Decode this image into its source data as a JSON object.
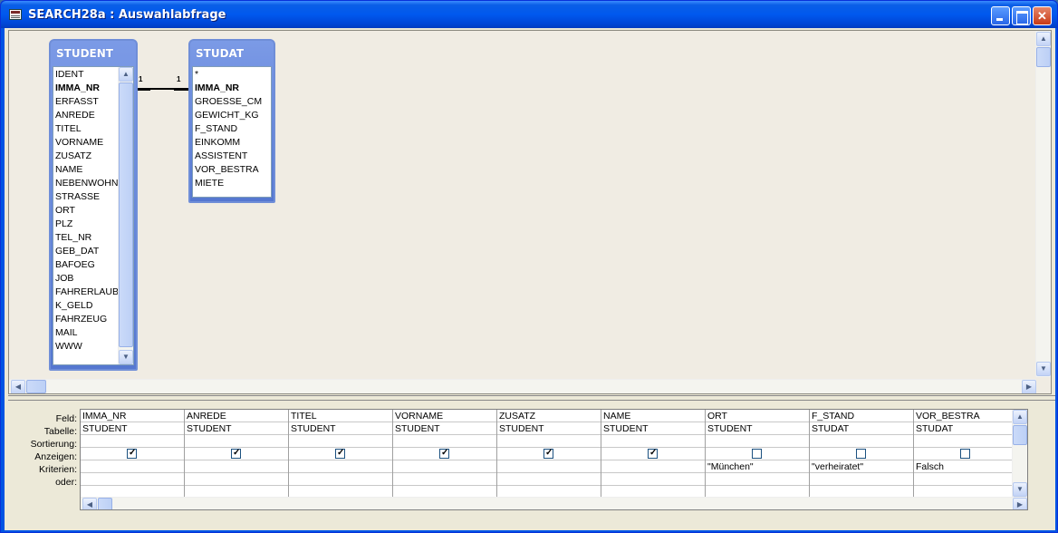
{
  "window": {
    "title": "SEARCH28a : Auswahlabfrage"
  },
  "tables": {
    "student": {
      "name": "STUDENT",
      "fields": [
        "IDENT",
        "IMMA_NR",
        "ERFASST",
        "ANREDE",
        "TITEL",
        "VORNAME",
        "ZUSATZ",
        "NAME",
        "NEBENWOHN",
        "STRASSE",
        "ORT",
        "PLZ",
        "TEL_NR",
        "GEB_DAT",
        "BAFOEG",
        "JOB",
        "FAHRERLAUB",
        "K_GELD",
        "FAHRZEUG",
        "MAIL",
        "WWW"
      ],
      "key_field": "IMMA_NR"
    },
    "studat": {
      "name": "STUDAT",
      "fields": [
        "*",
        "IMMA_NR",
        "GROESSE_CM",
        "GEWICHT_KG",
        "F_STAND",
        "EINKOMM",
        "ASSISTENT",
        "VOR_BESTRA",
        "MIETE"
      ],
      "key_field": "IMMA_NR"
    }
  },
  "relationship": {
    "left_label": "1",
    "right_label": "1"
  },
  "grid": {
    "row_labels": {
      "feld": "Feld:",
      "tabelle": "Tabelle:",
      "sortierung": "Sortierung:",
      "anzeigen": "Anzeigen:",
      "kriterien": "Kriterien:",
      "oder": "oder:"
    },
    "columns": [
      {
        "feld": "IMMA_NR",
        "tabelle": "STUDENT",
        "sortierung": "",
        "anzeigen": true,
        "kriterien": ""
      },
      {
        "feld": "ANREDE",
        "tabelle": "STUDENT",
        "sortierung": "",
        "anzeigen": true,
        "kriterien": ""
      },
      {
        "feld": "TITEL",
        "tabelle": "STUDENT",
        "sortierung": "",
        "anzeigen": true,
        "kriterien": ""
      },
      {
        "feld": "VORNAME",
        "tabelle": "STUDENT",
        "sortierung": "",
        "anzeigen": true,
        "kriterien": ""
      },
      {
        "feld": "ZUSATZ",
        "tabelle": "STUDENT",
        "sortierung": "",
        "anzeigen": true,
        "kriterien": ""
      },
      {
        "feld": "NAME",
        "tabelle": "STUDENT",
        "sortierung": "",
        "anzeigen": true,
        "kriterien": ""
      },
      {
        "feld": "ORT",
        "tabelle": "STUDENT",
        "sortierung": "",
        "anzeigen": false,
        "kriterien": "\"München\""
      },
      {
        "feld": "F_STAND",
        "tabelle": "STUDAT",
        "sortierung": "",
        "anzeigen": false,
        "kriterien": "\"verheiratet\""
      },
      {
        "feld": "VOR_BESTRA",
        "tabelle": "STUDAT",
        "sortierung": "",
        "anzeigen": false,
        "kriterien": "Falsch"
      }
    ]
  },
  "colors": {
    "title_bar": "#0058ee",
    "field_list_header": "#6f8ed8",
    "design_background": "#f0ece3"
  },
  "icons": {
    "window": "query-icon",
    "minimize": "minimize-icon",
    "maximize": "maximize-icon",
    "close": "close-icon"
  }
}
